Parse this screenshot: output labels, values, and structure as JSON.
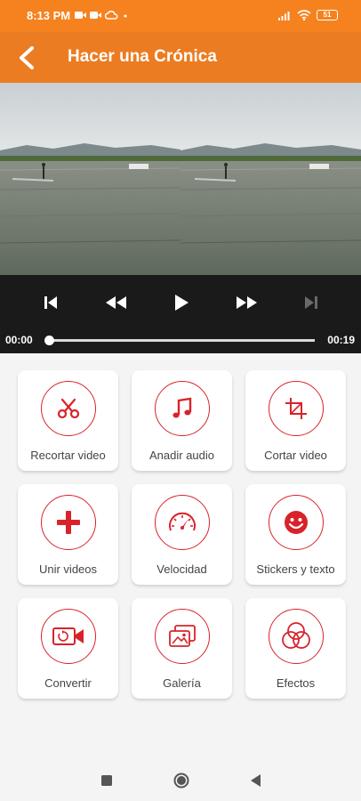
{
  "status_bar": {
    "time": "8:13 PM",
    "battery": "51",
    "left_icons": [
      "video-icon",
      "video-icon",
      "cloud-icon",
      "dot-icon"
    ],
    "right_icons": [
      "signal-icon",
      "wifi-icon",
      "battery-icon"
    ]
  },
  "app_bar": {
    "title": "Hacer una Crónica",
    "back_icon": "back-arrow-icon",
    "color": "#ec7c21"
  },
  "player": {
    "current_time": "00:00",
    "total_time": "00:19",
    "progress": 0,
    "controls": [
      "skip-previous-icon",
      "rewind-icon",
      "play-icon",
      "fast-forward-icon",
      "skip-next-icon"
    ],
    "skip_next_enabled": false
  },
  "actions": [
    {
      "label": "Recortar video",
      "icon": "scissors-icon"
    },
    {
      "label": "Anadir audio",
      "icon": "music-note-icon"
    },
    {
      "label": "Cortar video",
      "icon": "crop-icon"
    },
    {
      "label": "Unir videos",
      "icon": "plus-icon"
    },
    {
      "label": "Velocidad",
      "icon": "speedometer-icon"
    },
    {
      "label": "Stickers y texto",
      "icon": "smiley-icon"
    },
    {
      "label": "Convertir",
      "icon": "camera-convert-icon"
    },
    {
      "label": "Galería",
      "icon": "gallery-icon"
    },
    {
      "label": "Efectos",
      "icon": "effects-icon"
    }
  ],
  "accent_color": "#d8232a",
  "nav_bar": [
    "square-icon",
    "circle-icon",
    "triangle-back-icon"
  ]
}
